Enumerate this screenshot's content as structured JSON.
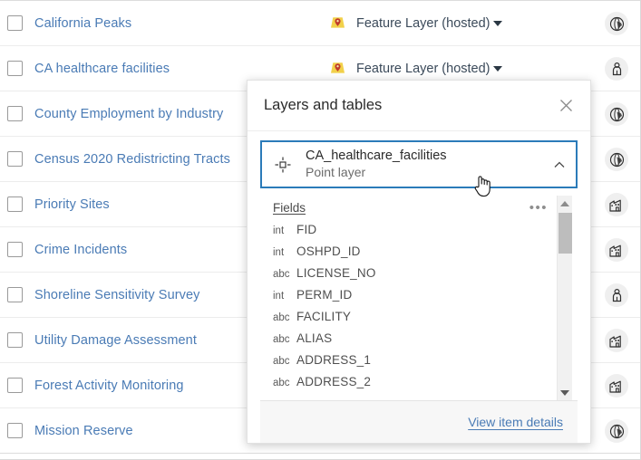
{
  "list": {
    "rows": [
      {
        "title": "California Peaks",
        "type": "Feature Layer (hosted)",
        "type_icon": "map-pin-icon",
        "owner_icon": "globe-icon"
      },
      {
        "title": "CA healthcare facilities",
        "type": "Feature Layer (hosted)",
        "type_icon": "map-pin-icon",
        "owner_icon": "person-icon"
      },
      {
        "title": "County Employment by Industry",
        "type": "",
        "type_icon": "",
        "owner_icon": "globe-icon"
      },
      {
        "title": "Census 2020 Redistricting Tracts",
        "type": "",
        "type_icon": "",
        "owner_icon": "globe-icon"
      },
      {
        "title": "Priority Sites",
        "type": "",
        "type_icon": "",
        "owner_icon": "building-icon"
      },
      {
        "title": "Crime Incidents",
        "type": "",
        "type_icon": "",
        "owner_icon": "building-icon"
      },
      {
        "title": "Shoreline Sensitivity Survey",
        "type": "",
        "type_icon": "",
        "owner_icon": "person-icon"
      },
      {
        "title": "Utility Damage Assessment",
        "type": "",
        "type_icon": "",
        "owner_icon": "building-icon"
      },
      {
        "title": "Forest Activity Monitoring",
        "type": "",
        "type_icon": "",
        "owner_icon": "building-icon"
      },
      {
        "title": "Mission Reserve",
        "type": "",
        "type_icon": "",
        "owner_icon": "globe-icon"
      }
    ]
  },
  "popup": {
    "title": "Layers and tables",
    "close_icon": "close-icon",
    "layer": {
      "icon": "point-layer-crosshair-icon",
      "name": "CA_healthcare_facilities",
      "subtitle": "Point layer",
      "collapse_icon": "chevron-up-icon"
    },
    "fields_header": {
      "label": "Fields",
      "menu_icon": "ellipsis-icon",
      "menu_label": "•••"
    },
    "fields": [
      {
        "type": "int",
        "name": "FID"
      },
      {
        "type": "int",
        "name": "OSHPD_ID"
      },
      {
        "type": "abc",
        "name": "LICENSE_NO"
      },
      {
        "type": "int",
        "name": "PERM_ID"
      },
      {
        "type": "abc",
        "name": "FACILITY"
      },
      {
        "type": "abc",
        "name": "ALIAS"
      },
      {
        "type": "abc",
        "name": "ADDRESS_1"
      },
      {
        "type": "abc",
        "name": "ADDRESS_2"
      }
    ],
    "scrollbar": {
      "up_icon": "scroll-up-arrow-icon",
      "down_icon": "scroll-down-arrow-icon"
    },
    "footer_link": "View item details"
  },
  "cursor": {
    "icon": "pointing-hand-cursor"
  },
  "colors": {
    "link": "#4a7bb5",
    "selected_border": "#2b7bb9",
    "pin_base": "#f2d14a",
    "pin_marker": "#c0392b",
    "text": "#2b2b2b",
    "muted": "#6b6b6b"
  }
}
